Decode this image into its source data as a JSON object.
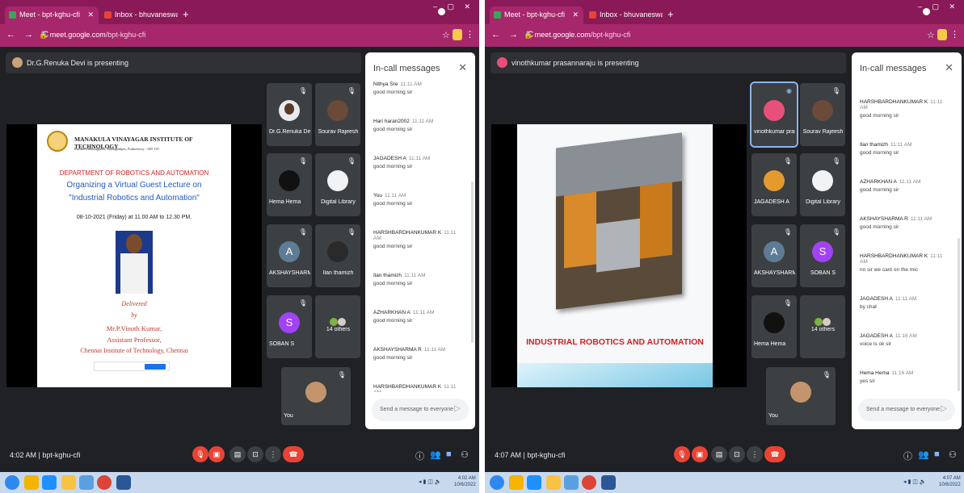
{
  "left": {
    "tabs": [
      {
        "title": "Meet - bpt-kghu-cfi"
      },
      {
        "title": "Inbox - bhuvaneswarimse2020@"
      }
    ],
    "url": {
      "domain": "meet.google.com",
      "path": "/bpt-kghu-cfi"
    },
    "presenting": "Dr.G.Renuka Devi is presenting",
    "slide": {
      "institute": "MANAKULA VINAYAGAR INSTITUTE OF TECHNOLOGY",
      "address": "Kalitheerthalkuppam, Madagadipet, Puducherry - 605 107",
      "dept": "DEPARTMENT OF ROBOTICS AND AUTOMATION",
      "organizing": "Organizing a Virtual Guest Lecture on",
      "topic": "\"Industrial Robotics and Automation\"",
      "date": "08-10-2021 (Friday) at 11.00 AM to 12.30 PM.",
      "delivered": "Delivered",
      "by": "by",
      "speaker": "Mr.P.Vinoth Kumar,",
      "designation": "Assistant Professor,",
      "college": "Chennai Institute of Technology, Chennai"
    },
    "tiles": [
      {
        "name": "Dr.G.Renuka Devi"
      },
      {
        "name": "Sourav Rajeesh"
      },
      {
        "name": "Hema Hema"
      },
      {
        "name": "Digital Library"
      },
      {
        "name": "AKSHAYSHARMA R",
        "initial": "A",
        "color": "#5f7c96"
      },
      {
        "name": "Ilan thamizh"
      },
      {
        "name": "SOBAN S",
        "initial": "S",
        "color": "#a142f4"
      },
      {
        "name": "14 others"
      },
      {
        "name": "You"
      }
    ],
    "chat": {
      "title": "In-call messages",
      "placeholder": "Send a message to everyone",
      "messages": [
        {
          "sender": "Nithya Sre",
          "time": "11:11 AM",
          "text": "good morning sir"
        },
        {
          "sender": "Hari haran2002",
          "time": "11:11 AM",
          "text": "good morning sir"
        },
        {
          "sender": "JAGADESH A",
          "time": "11:11 AM",
          "text": "good morning sir"
        },
        {
          "sender": "You",
          "time": "11:11 AM",
          "text": "good morning sir"
        },
        {
          "sender": "HARSHBARDHANKUMAR K",
          "time": "11:11 AM",
          "text": "good morning sir"
        },
        {
          "sender": "Ilan thamizh",
          "time": "11:11 AM",
          "text": "good morning sir"
        },
        {
          "sender": "AZHARKHAN A",
          "time": "11:11 AM",
          "text": "good morning sir"
        },
        {
          "sender": "AKSHAYSHARMA R",
          "time": "11:11 AM",
          "text": "good morning sir"
        },
        {
          "sender": "HARSHBARDHANKUMAR K",
          "time": "11:11 AM",
          "text": ""
        }
      ]
    },
    "bottom": {
      "time": "4:02 AM",
      "code": "bpt-kghu-cfi"
    },
    "taskbar": {
      "time": "4:02 AM",
      "date": "10/6/2022"
    }
  },
  "right": {
    "tabs": [
      {
        "title": "Meet - bpt-kghu-cfi"
      },
      {
        "title": "Inbox - bhuvaneswarimse2020@"
      }
    ],
    "url": {
      "domain": "meet.google.com",
      "path": "/bpt-kghu-cfi"
    },
    "presenting": "vinothkumar prasannaraju is presenting",
    "slide": {
      "title": "INDUSTRIAL ROBOTICS AND AUTOMATION"
    },
    "tiles": [
      {
        "name": "vinothkumar pras..."
      },
      {
        "name": "Sourav Rajeesh"
      },
      {
        "name": "JAGADESH A"
      },
      {
        "name": "Digital Library"
      },
      {
        "name": "AKSHAYSHARMA R",
        "initial": "A",
        "color": "#5f7c96"
      },
      {
        "name": "SOBAN S",
        "initial": "S",
        "color": "#a142f4"
      },
      {
        "name": "Hema Hema"
      },
      {
        "name": "14 others"
      },
      {
        "name": "You"
      }
    ],
    "chat": {
      "title": "In-call messages",
      "placeholder": "Send a message to everyone",
      "messages": [
        {
          "sender": "HARSHBARDHANKUMAR K",
          "time": "11:11 AM",
          "text": "good morning sir"
        },
        {
          "sender": "Ilan thamizh",
          "time": "11:11 AM",
          "text": "good morning sir"
        },
        {
          "sender": "AZHARKHAN A",
          "time": "11:11 AM",
          "text": "good morning sir"
        },
        {
          "sender": "AKSHAYSHARMA R",
          "time": "11:11 AM",
          "text": "good morning sir"
        },
        {
          "sender": "HARSHBARDHANKUMAR K",
          "time": "11:11 AM",
          "text": "no sir we cant on the mic"
        },
        {
          "sender": "JAGADESH A",
          "time": "11:11 AM",
          "text": "by chat"
        },
        {
          "sender": "JAGADESH A",
          "time": "11:16 AM",
          "text": "voice is ok sir"
        },
        {
          "sender": "Hema Hema",
          "time": "11:16 AM",
          "text": "yes sir"
        }
      ]
    },
    "bottom": {
      "time": "4:07 AM",
      "code": "bpt-kghu-cfi"
    },
    "taskbar": {
      "time": "4:07 AM",
      "date": "10/6/2022"
    }
  },
  "icons": {
    "mic_off": "mic-off-icon",
    "cam_off": "camera-off-icon",
    "captions": "captions-icon",
    "present": "present-icon",
    "more": "more-icon",
    "hangup": "hangup-icon",
    "info": "info-icon",
    "people": "people-icon",
    "chat": "chat-icon",
    "activities": "activities-icon"
  },
  "colors": {
    "chrome_tab": "#8a1a57",
    "meet_bg": "#202124",
    "tile_bg": "#3c4043",
    "hangup": "#ea4335",
    "speaking": "#8ab4f8"
  }
}
